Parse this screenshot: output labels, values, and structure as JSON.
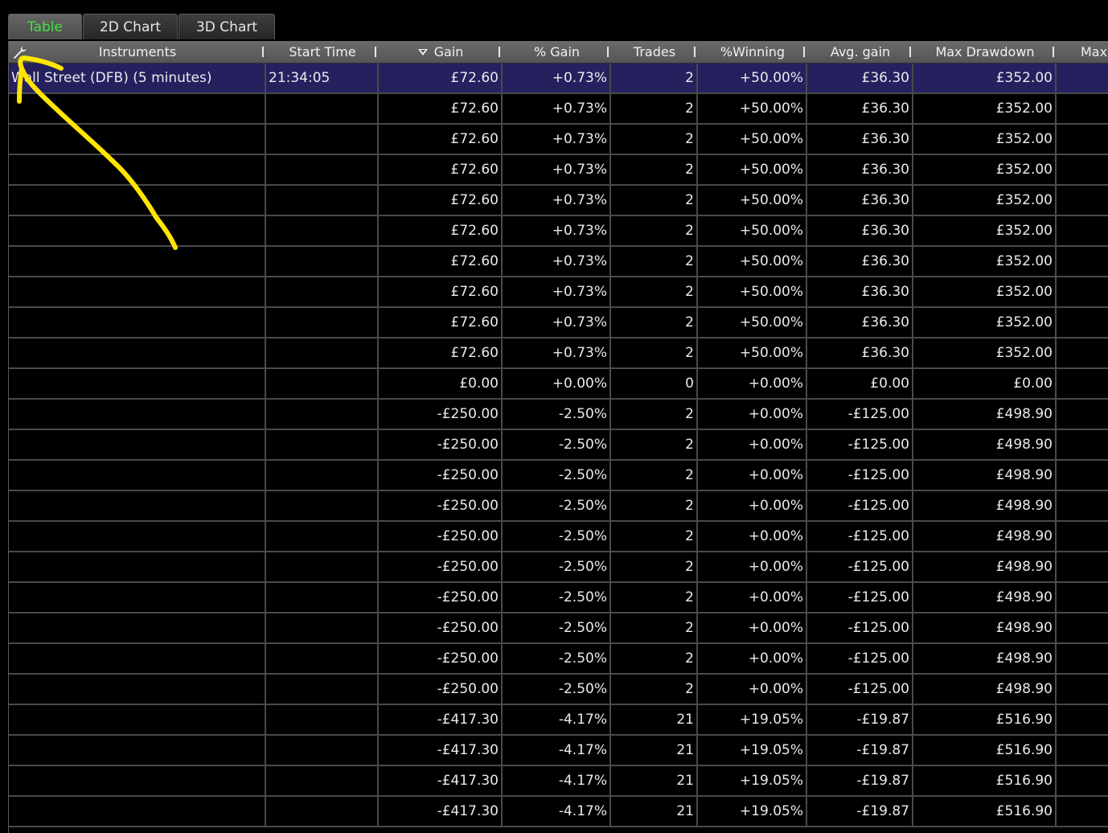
{
  "tabs": [
    {
      "label": "Table",
      "active": true
    },
    {
      "label": "2D Chart",
      "active": false
    },
    {
      "label": "3D Chart",
      "active": false
    }
  ],
  "columns": [
    "Instruments",
    "Start Time",
    "Gain",
    "% Gain",
    "Trades",
    "%Winning",
    "Avg. gain",
    "Max Drawdown",
    "Max"
  ],
  "sorted_column": "Gain",
  "rows": [
    [
      "Wall Street (DFB) (5 minutes)",
      "21:34:05",
      "£72.60",
      "+0.73%",
      "2",
      "+50.00%",
      "£36.30",
      "£352.00",
      ""
    ],
    [
      "",
      "",
      "£72.60",
      "+0.73%",
      "2",
      "+50.00%",
      "£36.30",
      "£352.00",
      ""
    ],
    [
      "",
      "",
      "£72.60",
      "+0.73%",
      "2",
      "+50.00%",
      "£36.30",
      "£352.00",
      ""
    ],
    [
      "",
      "",
      "£72.60",
      "+0.73%",
      "2",
      "+50.00%",
      "£36.30",
      "£352.00",
      ""
    ],
    [
      "",
      "",
      "£72.60",
      "+0.73%",
      "2",
      "+50.00%",
      "£36.30",
      "£352.00",
      ""
    ],
    [
      "",
      "",
      "£72.60",
      "+0.73%",
      "2",
      "+50.00%",
      "£36.30",
      "£352.00",
      ""
    ],
    [
      "",
      "",
      "£72.60",
      "+0.73%",
      "2",
      "+50.00%",
      "£36.30",
      "£352.00",
      ""
    ],
    [
      "",
      "",
      "£72.60",
      "+0.73%",
      "2",
      "+50.00%",
      "£36.30",
      "£352.00",
      ""
    ],
    [
      "",
      "",
      "£72.60",
      "+0.73%",
      "2",
      "+50.00%",
      "£36.30",
      "£352.00",
      ""
    ],
    [
      "",
      "",
      "£72.60",
      "+0.73%",
      "2",
      "+50.00%",
      "£36.30",
      "£352.00",
      ""
    ],
    [
      "",
      "",
      "£0.00",
      "+0.00%",
      "0",
      "+0.00%",
      "£0.00",
      "£0.00",
      ""
    ],
    [
      "",
      "",
      "-£250.00",
      "-2.50%",
      "2",
      "+0.00%",
      "-£125.00",
      "£498.90",
      ""
    ],
    [
      "",
      "",
      "-£250.00",
      "-2.50%",
      "2",
      "+0.00%",
      "-£125.00",
      "£498.90",
      ""
    ],
    [
      "",
      "",
      "-£250.00",
      "-2.50%",
      "2",
      "+0.00%",
      "-£125.00",
      "£498.90",
      ""
    ],
    [
      "",
      "",
      "-£250.00",
      "-2.50%",
      "2",
      "+0.00%",
      "-£125.00",
      "£498.90",
      ""
    ],
    [
      "",
      "",
      "-£250.00",
      "-2.50%",
      "2",
      "+0.00%",
      "-£125.00",
      "£498.90",
      ""
    ],
    [
      "",
      "",
      "-£250.00",
      "-2.50%",
      "2",
      "+0.00%",
      "-£125.00",
      "£498.90",
      ""
    ],
    [
      "",
      "",
      "-£250.00",
      "-2.50%",
      "2",
      "+0.00%",
      "-£125.00",
      "£498.90",
      ""
    ],
    [
      "",
      "",
      "-£250.00",
      "-2.50%",
      "2",
      "+0.00%",
      "-£125.00",
      "£498.90",
      ""
    ],
    [
      "",
      "",
      "-£250.00",
      "-2.50%",
      "2",
      "+0.00%",
      "-£125.00",
      "£498.90",
      ""
    ],
    [
      "",
      "",
      "-£250.00",
      "-2.50%",
      "2",
      "+0.00%",
      "-£125.00",
      "£498.90",
      ""
    ],
    [
      "",
      "",
      "-£417.30",
      "-4.17%",
      "21",
      "+19.05%",
      "-£19.87",
      "£516.90",
      ""
    ],
    [
      "",
      "",
      "-£417.30",
      "-4.17%",
      "21",
      "+19.05%",
      "-£19.87",
      "£516.90",
      ""
    ],
    [
      "",
      "",
      "-£417.30",
      "-4.17%",
      "21",
      "+19.05%",
      "-£19.87",
      "£516.90",
      ""
    ],
    [
      "",
      "",
      "-£417.30",
      "-4.17%",
      "21",
      "+19.05%",
      "-£19.87",
      "£516.90",
      ""
    ]
  ],
  "selected_row": 0,
  "icons": {
    "settings": "wrench-icon",
    "sort": "sort-descending-icon",
    "annotation": "annotation-arrow"
  },
  "colors": {
    "background": "#000000",
    "active_tab_text": "#3fe33f",
    "selected_row": "#25215f",
    "grid_line": "#4a4a4a",
    "annotation": "#ffe600"
  }
}
